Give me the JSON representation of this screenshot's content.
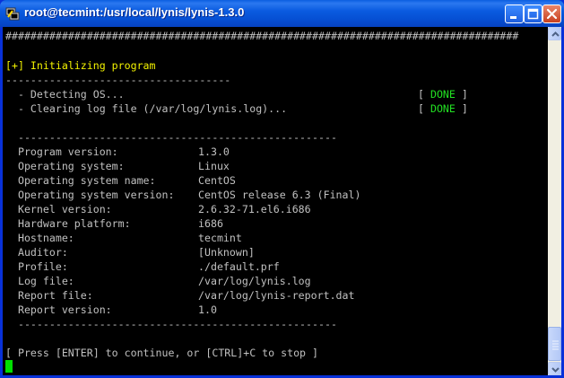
{
  "window": {
    "title": "root@tecmint:/usr/local/lynis/lynis-1.3.0",
    "icon": "putty-terminal-icon",
    "controls": [
      "minimize",
      "maximize",
      "close"
    ]
  },
  "terminal": {
    "hash_rule": "##################################################################################",
    "section_header": "[+] Initializing program",
    "header_rule": "------------------------------------",
    "tasks": [
      {
        "text": "  - Detecting OS...",
        "open": "[ ",
        "status": "DONE",
        "close": " ]"
      },
      {
        "text": "  - Clearing log file (/var/log/lynis.log)...",
        "open": "[ ",
        "status": "DONE",
        "close": " ]"
      }
    ],
    "info_rule": "  ---------------------------------------------------",
    "info_rule_bottom": "  ---------------------------------------------------",
    "info": [
      {
        "label": "  Program version:",
        "value": "1.3.0"
      },
      {
        "label": "  Operating system:",
        "value": "Linux"
      },
      {
        "label": "  Operating system name:",
        "value": "CentOS"
      },
      {
        "label": "  Operating system version:",
        "value": "CentOS release 6.3 (Final)"
      },
      {
        "label": "  Kernel version:",
        "value": "2.6.32-71.el6.i686"
      },
      {
        "label": "  Hardware platform:",
        "value": "i686"
      },
      {
        "label": "  Hostname:",
        "value": "tecmint"
      },
      {
        "label": "  Auditor:",
        "value": "[Unknown]"
      },
      {
        "label": "  Profile:",
        "value": "./default.prf"
      },
      {
        "label": "  Log file:",
        "value": "/var/log/lynis.log"
      },
      {
        "label": "  Report file:",
        "value": "/var/log/lynis-report.dat"
      },
      {
        "label": "  Report version:",
        "value": "1.0"
      }
    ],
    "prompt": "[ Press [ENTER] to continue, or [CTRL]+C to stop ]"
  },
  "colors": {
    "titlebar": "#0a5be0",
    "terminal_bg": "#000000",
    "text": "#c0c0c0",
    "header": "#f2f200",
    "done": "#22e022",
    "cursor": "#00e000"
  }
}
